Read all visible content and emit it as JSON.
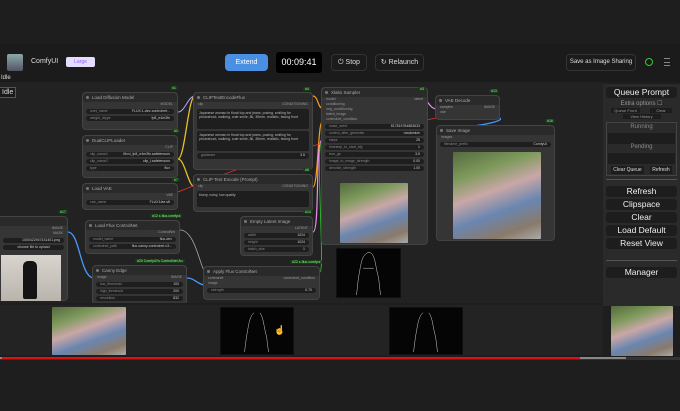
{
  "header": {
    "app_name": "ComfyUI",
    "badge": "Large",
    "extend_label": "Extend",
    "timer": "00:09:41",
    "stop_label": "Stop",
    "relaunch_label": "Relaunch",
    "share_label": "Save as Image Sharing"
  },
  "canvas": {
    "status": "Idle",
    "status_small": "Idle",
    "nodes": {
      "load_diffusion": {
        "title": "Load Diffusion Model",
        "id": "#1",
        "output": "MODEL",
        "w": [
          [
            "unet_name",
            "FLUX.1-dev-controlnet..."
          ],
          [
            "weight_dtype",
            "fp8_e4m3fn"
          ]
        ]
      },
      "dual_clip": {
        "title": "DualCLIPLoader",
        "id": "#2",
        "output": "CLIP",
        "w": [
          [
            "clip_name1",
            "t5xxl_fp8_e4m3fn.safetensors"
          ],
          [
            "clip_name2",
            "clip_l.safetensors"
          ],
          [
            "type",
            "flux"
          ]
        ]
      },
      "load_vae": {
        "title": "Load VAE",
        "id": "#7",
        "output": "VAE",
        "w": [
          [
            "vae_name",
            "FLUX1/ae.sft"
          ]
        ]
      },
      "load_controlnet": {
        "title": "Load Flux ControlNet",
        "id": "#12 x-flux-comfyui",
        "output": "ControlNet",
        "w": [
          [
            "model_name",
            "flux-dev"
          ],
          [
            "controlnet_path",
            "flux-canny-controlnet-v3..."
          ]
        ]
      },
      "canny": {
        "title": "Canny Edge",
        "id": "#20 ComfyUI's ControlNet Au",
        "input": "image",
        "output": "IMAGE",
        "w": [
          [
            "low_threshold",
            "100"
          ],
          [
            "high_threshold",
            "200"
          ],
          [
            "resolution",
            "832"
          ]
        ]
      },
      "clip_flux": {
        "title": "CLIPTextEncodeFlux",
        "id": "#4",
        "input": "clip",
        "output": "CONDITIONING",
        "text1": "Japanese woman in floral top and jeans, posing, smiling for photoshoot, walking, cute smile, 8k, 35mm, realistic, facing front",
        "text2": "Japanese woman in floral top and jeans, posing, smiling for photoshoot, walking, cute smile, 8k, 35mm, realistic, facing front",
        "w": [
          [
            "guidance",
            "3.5"
          ]
        ]
      },
      "clip_prompt": {
        "title": "CLIP Text Encode (Prompt)",
        "id": "#5",
        "input": "clip",
        "output": "CONDITIONING",
        "text": "blurry, noisy, low quality"
      },
      "empty_latent": {
        "title": "Empty Latent Image",
        "id": "#14",
        "output": "LATENT",
        "w": [
          [
            "width",
            "1024"
          ],
          [
            "height",
            "1024"
          ],
          [
            "batch_size",
            "1"
          ]
        ]
      },
      "apply_controlnet": {
        "title": "Apply Flux ControlNet",
        "id": "#22 x-flux-comfyui",
        "in1": "controlnet",
        "in2": "image",
        "output": "controlnet_condition",
        "w": [
          [
            "strength",
            "0.70"
          ]
        ]
      },
      "sampler": {
        "title": "Xlabs Sampler",
        "id": "#3",
        "output": "latent",
        "inputs": [
          "model",
          "conditioning",
          "neg_conditioning",
          "latent_image",
          "controlnet_condition"
        ],
        "w": [
          [
            "noise_seed",
            "817819784883633"
          ],
          [
            "control_after_generate",
            "randomize"
          ],
          [
            "steps",
            "25"
          ],
          [
            "timestep_to_start_cfg",
            "1"
          ],
          [
            "true_gs",
            "3.5"
          ],
          [
            "image_to_image_strength",
            "0.00"
          ],
          [
            "denoise_strength",
            "1.00"
          ]
        ]
      },
      "vae_decode": {
        "title": "VAE Decode",
        "id": "#13",
        "in1": "samples",
        "in2": "vae",
        "output": "IMAGE"
      },
      "save_image": {
        "title": "Save Image",
        "id": "#16",
        "input": "images",
        "w": [
          [
            "filename_prefix",
            "ComfyUI"
          ]
        ]
      },
      "load_image": {
        "id": "#17",
        "out1": "IMAGE",
        "out2": "MASK",
        "file": "1000422947431401.png",
        "upload": "choose file to upload"
      }
    }
  },
  "sidebar": {
    "queue_prompt": "Queue Prompt",
    "extra_options": "Extra options",
    "queue_front": "Queue Front",
    "clear_small": "Clear",
    "view_history": "View History",
    "running": "Running",
    "pending": "Pending",
    "clear_queue": "Clear Queue",
    "refresh_small": "Refresh",
    "buttons": [
      "Refresh",
      "Clipspace",
      "Clear",
      "Load Default",
      "Reset View"
    ],
    "manager": "Manager"
  },
  "player": {
    "played": 0.85,
    "buffered": 0.92
  }
}
